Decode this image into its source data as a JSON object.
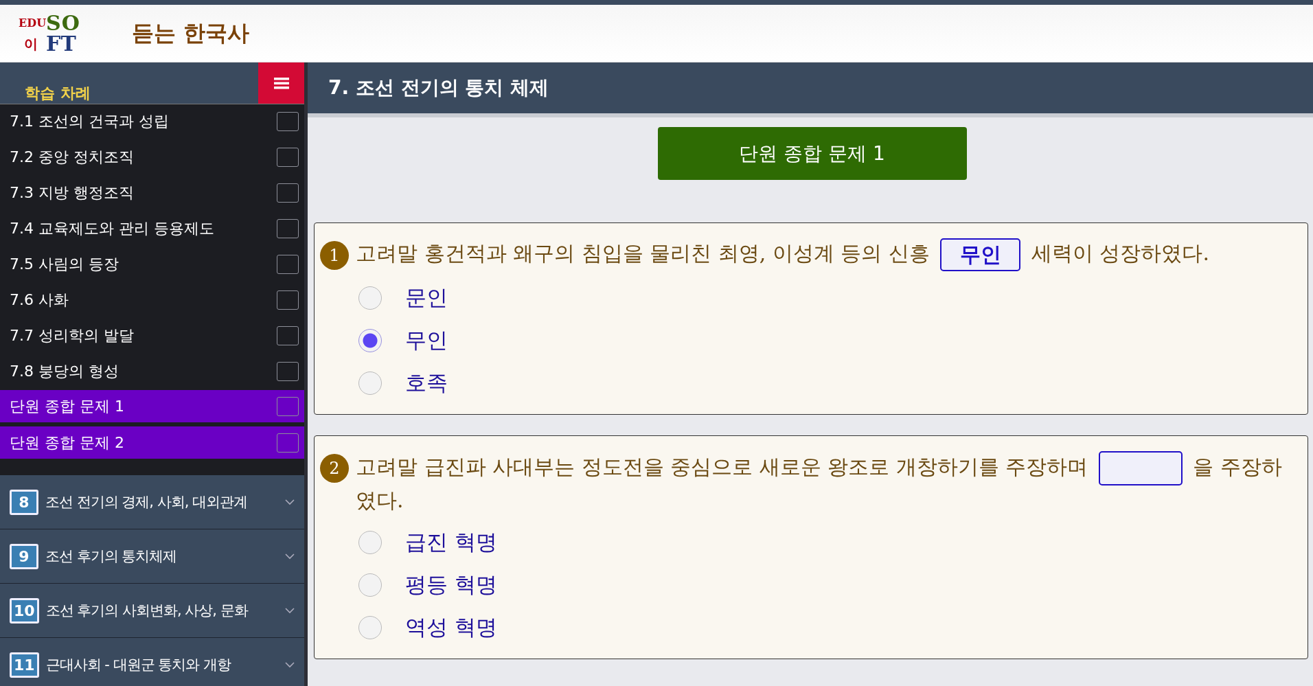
{
  "header": {
    "logo": {
      "top_left": "EDU",
      "top_right": "SO",
      "bottom_left": "이",
      "bottom_right": "FT"
    },
    "title": "듣는 한국사"
  },
  "sidebar": {
    "title": "학습 차례",
    "lessons": [
      {
        "label": "7.1 조선의 건국과 성립",
        "kind": "lesson",
        "checked": false
      },
      {
        "label": "7.2 중앙 정치조직",
        "kind": "lesson",
        "checked": false
      },
      {
        "label": "7.3 지방 행정조직",
        "kind": "lesson",
        "checked": false
      },
      {
        "label": "7.4 교육제도와 관리 등용제도",
        "kind": "lesson",
        "checked": false
      },
      {
        "label": "7.5 사림의 등장",
        "kind": "lesson",
        "checked": false
      },
      {
        "label": "7.6 사화",
        "kind": "lesson",
        "checked": false
      },
      {
        "label": "7.7 성리학의 발달",
        "kind": "lesson",
        "checked": false
      },
      {
        "label": "7.8 붕당의 형성",
        "kind": "lesson",
        "checked": false
      },
      {
        "label": "단원 종합 문제 1",
        "kind": "quiz",
        "checked": false
      },
      {
        "label": "단원 종합 문제 2",
        "kind": "quiz",
        "checked": false
      }
    ],
    "chapters": [
      {
        "number": "8",
        "title": "조선 전기의 경제, 사회, 대외관계",
        "expanded": false
      },
      {
        "number": "9",
        "title": "조선 후기의 통치체제",
        "expanded": false
      },
      {
        "number": "10",
        "title": "조선 후기의 사회변화, 사상, 문화",
        "expanded": false
      },
      {
        "number": "11",
        "title": "근대사회 - 대원군 통치와 개항",
        "expanded": false
      }
    ]
  },
  "main": {
    "title": "7. 조선 전기의 통치 체제",
    "quiz_button": "단원 종합 문제 1",
    "questions": [
      {
        "number": "1",
        "text_before": "고려말 홍건적과 왜구의 침입을 물리친 최영, 이성계 등의 신흥",
        "answer": "무인",
        "text_after": "세력이 성장하였다.",
        "options": [
          {
            "label": "문인",
            "selected": false
          },
          {
            "label": "무인",
            "selected": true
          },
          {
            "label": "호족",
            "selected": false
          }
        ]
      },
      {
        "number": "2",
        "text_before": "고려말 급진파 사대부는 정도전을 중심으로 새로운 왕조로 개창하기를 주장하며",
        "text_after": "을 주장하였다.",
        "options": [
          {
            "label": "급진 혁명",
            "selected": false
          },
          {
            "label": "평등 혁명",
            "selected": false
          },
          {
            "label": "역성 혁명",
            "selected": false
          }
        ]
      }
    ]
  }
}
